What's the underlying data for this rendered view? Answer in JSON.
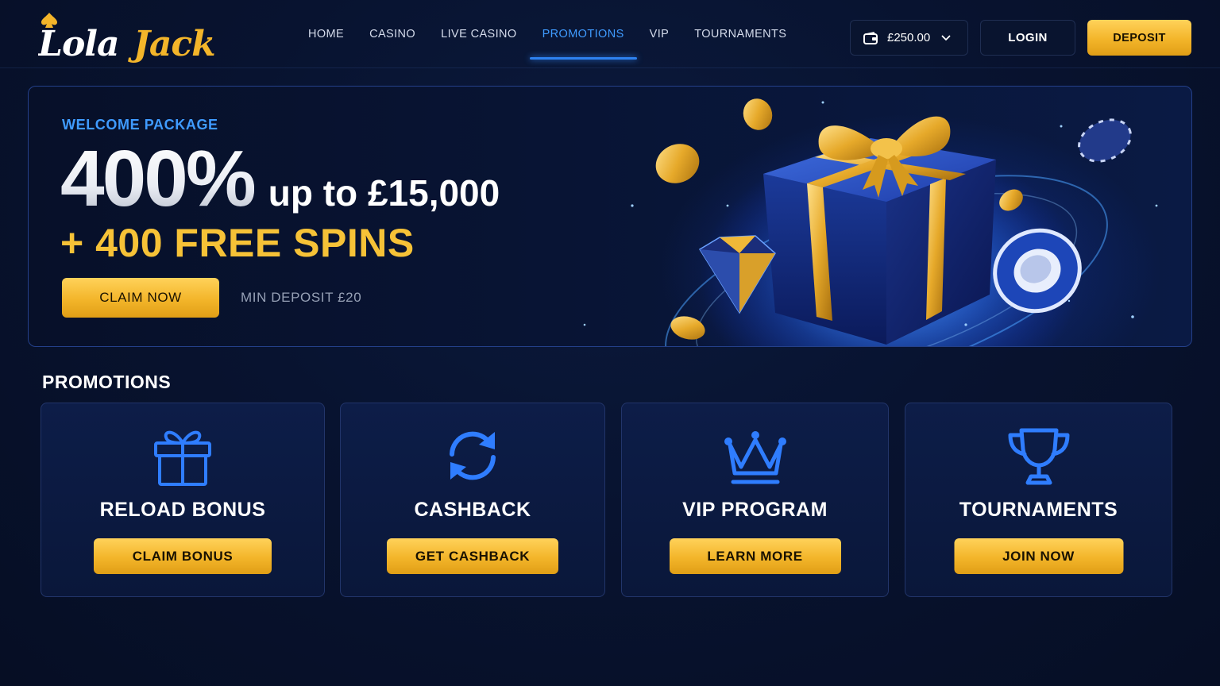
{
  "brand": {
    "logo_part1": "Lola",
    "logo_part2": "Jack",
    "colors": {
      "accent_blue": "#3f9bff",
      "gold": "#f6c237",
      "background": "#081330"
    }
  },
  "nav": {
    "items": [
      {
        "label": "HOME",
        "active": false
      },
      {
        "label": "CASINO",
        "active": false
      },
      {
        "label": "LIVE CASINO",
        "active": false
      },
      {
        "label": "PROMOTIONS",
        "active": true
      },
      {
        "label": "VIP",
        "active": false
      },
      {
        "label": "TOURNAMENTS",
        "active": false
      }
    ]
  },
  "account": {
    "balance": "£250.00",
    "wallet_icon": "wallet-icon",
    "login_label": "LOGIN",
    "deposit_label": "DEPOSIT"
  },
  "hero": {
    "eyebrow": "WELCOME PACKAGE",
    "percent": "400%",
    "upto": "up to £15,000",
    "spins": "+ 400 FREE SPINS",
    "cta_label": "CLAIM NOW",
    "min_deposit": "MIN DEPOSIT £20"
  },
  "promotions": {
    "title": "PROMOTIONS",
    "cards": [
      {
        "icon": "gift-icon",
        "title": "RELOAD BONUS",
        "button": "CLAIM BONUS"
      },
      {
        "icon": "refresh-icon",
        "title": "CASHBACK",
        "button": "GET CASHBACK"
      },
      {
        "icon": "crown-icon",
        "title": "VIP PROGRAM",
        "button": "LEARN MORE"
      },
      {
        "icon": "trophy-icon",
        "title": "TOURNAMENTS",
        "button": "JOIN NOW"
      }
    ]
  }
}
